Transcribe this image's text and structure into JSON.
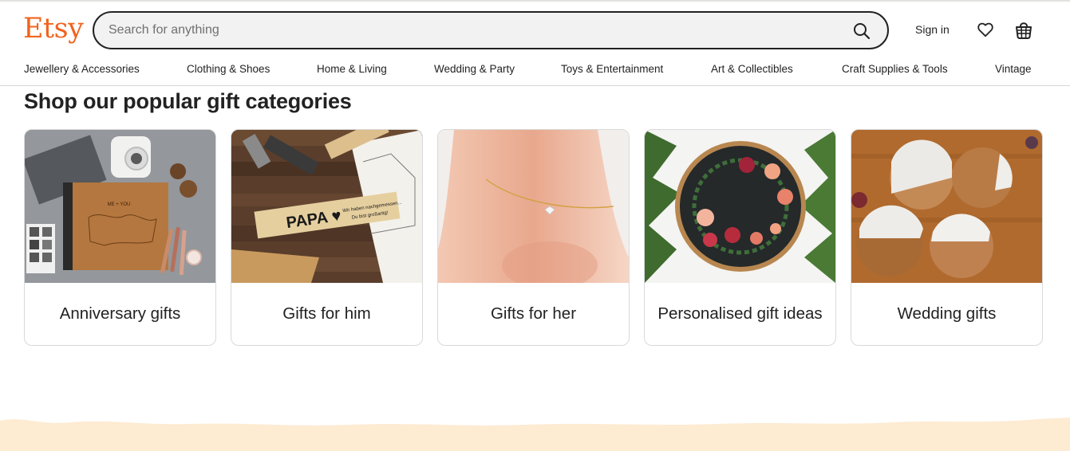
{
  "header": {
    "logo": "Etsy",
    "search_placeholder": "Search for anything",
    "sign_in": "Sign in",
    "icons": {
      "search": "search-icon",
      "favorites": "heart-icon",
      "cart": "basket-icon"
    },
    "brand_color": "#f1641e"
  },
  "categories": [
    "Jewellery & Accessories",
    "Clothing & Shoes",
    "Home & Living",
    "Wedding & Party",
    "Toys & Entertainment",
    "Art & Collectibles",
    "Craft Supplies & Tools",
    "Vintage"
  ],
  "section": {
    "title": "Shop our popular gift categories",
    "cards": [
      {
        "label": "Anniversary gifts"
      },
      {
        "label": "Gifts for him"
      },
      {
        "label": "Gifts for her"
      },
      {
        "label": "Personalised gift ideas"
      },
      {
        "label": "Wedding gifts"
      }
    ]
  },
  "footer_band_color": "#fdebd2"
}
